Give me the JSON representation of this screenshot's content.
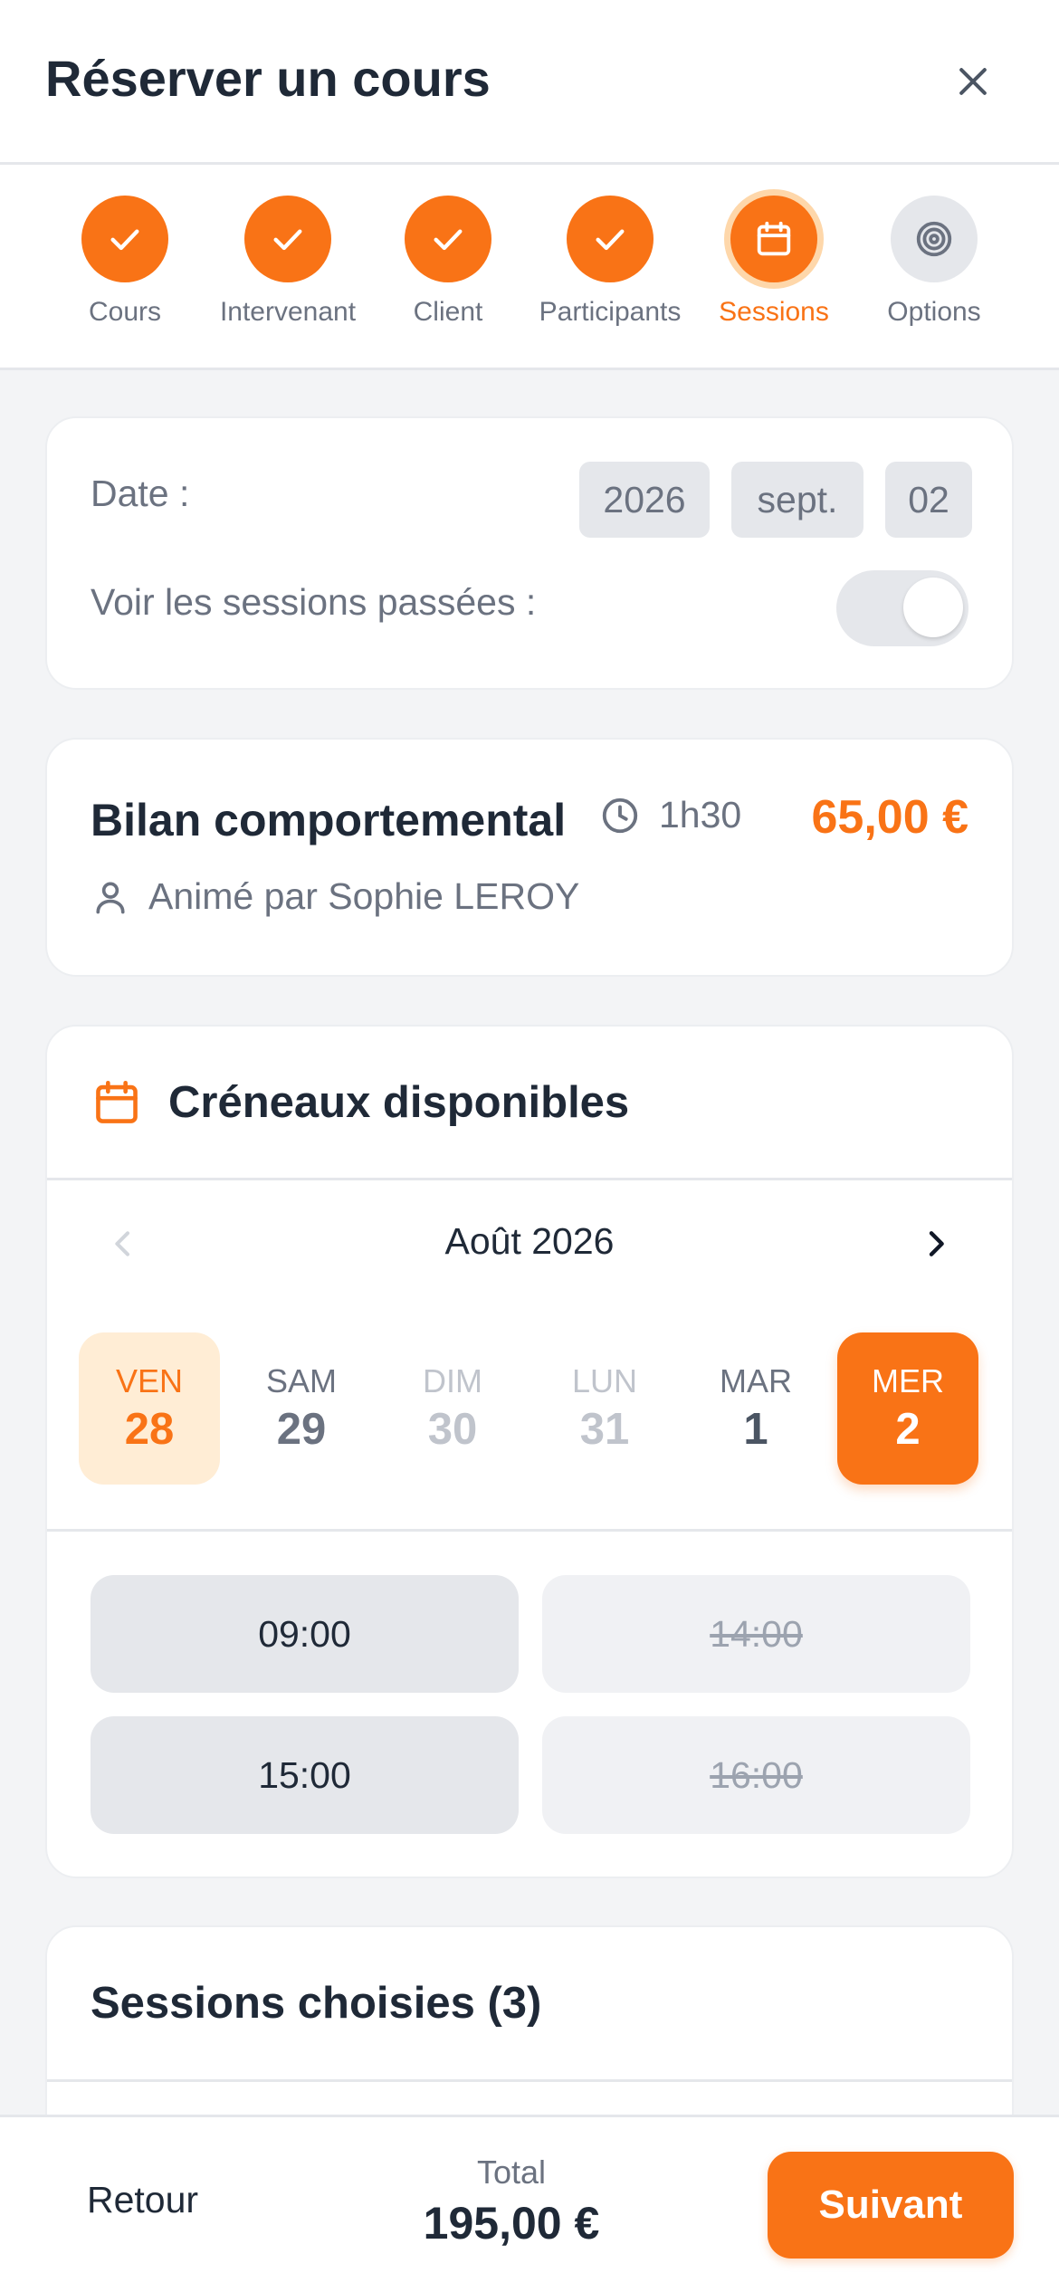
{
  "header": {
    "title": "Réserver un cours"
  },
  "stepper": {
    "steps": [
      {
        "label": "Cours",
        "state": "done",
        "icon": "check-icon"
      },
      {
        "label": "Intervenant",
        "state": "done",
        "icon": "check-icon"
      },
      {
        "label": "Client",
        "state": "done",
        "icon": "check-icon"
      },
      {
        "label": "Participants",
        "state": "done",
        "icon": "check-icon"
      },
      {
        "label": "Sessions",
        "state": "active",
        "icon": "calendar-icon"
      },
      {
        "label": "Options",
        "state": "pending",
        "icon": "target-icon"
      }
    ]
  },
  "date_filter": {
    "label": "Date :",
    "year": "2026",
    "month": "sept.",
    "day": "02",
    "past_sessions_label": "Voir les sessions passées :",
    "past_sessions_enabled": false
  },
  "course": {
    "title": "Bilan comportemental",
    "duration": "1h30",
    "price": "65,00 €",
    "animator": "Animé par Sophie LEROY"
  },
  "slots": {
    "title": "Créneaux disponibles",
    "month": "Août 2026",
    "days": [
      {
        "name": "VEN",
        "num": "28",
        "state": "today"
      },
      {
        "name": "SAM",
        "num": "29",
        "state": "normal"
      },
      {
        "name": "DIM",
        "num": "30",
        "state": "muted"
      },
      {
        "name": "LUN",
        "num": "31",
        "state": "muted"
      },
      {
        "name": "MAR",
        "num": "1",
        "state": "dark"
      },
      {
        "name": "MER",
        "num": "2",
        "state": "selected"
      }
    ],
    "times": [
      {
        "time": "09:00",
        "available": true
      },
      {
        "time": "14:00",
        "available": false
      },
      {
        "time": "15:00",
        "available": true
      },
      {
        "time": "16:00",
        "available": false
      }
    ]
  },
  "chosen": {
    "title": "Sessions choisies (3)"
  },
  "footer": {
    "back_label": "Retour",
    "total_label": "Total",
    "total_value": "195,00 €",
    "next_label": "Suivant"
  },
  "colors": {
    "accent": "#f97316",
    "accent_light": "#ffedd5",
    "muted": "#6b7280"
  }
}
